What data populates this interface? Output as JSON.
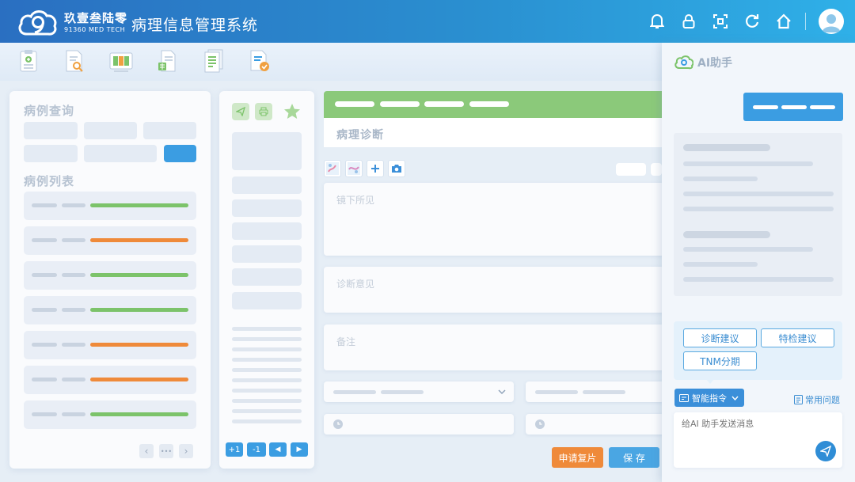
{
  "brand": {
    "name_cn": "玖壹叁陆零",
    "name_en": "91360 MED TECH"
  },
  "app": {
    "title": "病理信息管理系统"
  },
  "header": {
    "icons": [
      "bell-icon",
      "lock-icon",
      "scan-icon",
      "refresh-icon",
      "home-icon",
      "user-avatar"
    ]
  },
  "toolbar": {
    "icons": [
      "clipboard-icon",
      "document-search-icon",
      "chart-card-icon",
      "spreadsheet-icon",
      "document-list-icon",
      "document-check-icon"
    ]
  },
  "left_panel": {
    "query_title": "病例查询",
    "list_title": "病例列表",
    "rows": [
      {
        "status_color": "#7cc36a"
      },
      {
        "status_color": "#ef8a3a"
      },
      {
        "status_color": "#7cc36a"
      },
      {
        "status_color": "#7cc36a"
      },
      {
        "status_color": "#ef8a3a"
      },
      {
        "status_color": "#ef8a3a"
      },
      {
        "status_color": "#7cc36a"
      }
    ],
    "pagination": {
      "prev": "‹",
      "more": "•••",
      "next": "›"
    }
  },
  "middle_panel": {
    "nav": {
      "plus_one": "+1",
      "minus_one": "-1",
      "prev": "◀",
      "next": "▶"
    }
  },
  "diagnosis": {
    "title": "病理诊断",
    "microscopy_label": "镜下所见",
    "opinion_label": "诊断意见",
    "remarks_label": "备注"
  },
  "actions": {
    "request_review": "申请复片",
    "save": "保 存"
  },
  "colors": {
    "accent": "#3b9de2",
    "green": "#7cc36a",
    "orange": "#ef8a3a",
    "header_start": "#2a6fc1",
    "header_end": "#2fb0e8"
  },
  "ai_panel": {
    "title": "AI助手",
    "suggestions": [
      "诊断建议",
      "特检建议",
      "TNM分期"
    ],
    "command_label": "智能指令",
    "faq_label": "常用问题",
    "input_placeholder": "给AI 助手发送消息"
  }
}
